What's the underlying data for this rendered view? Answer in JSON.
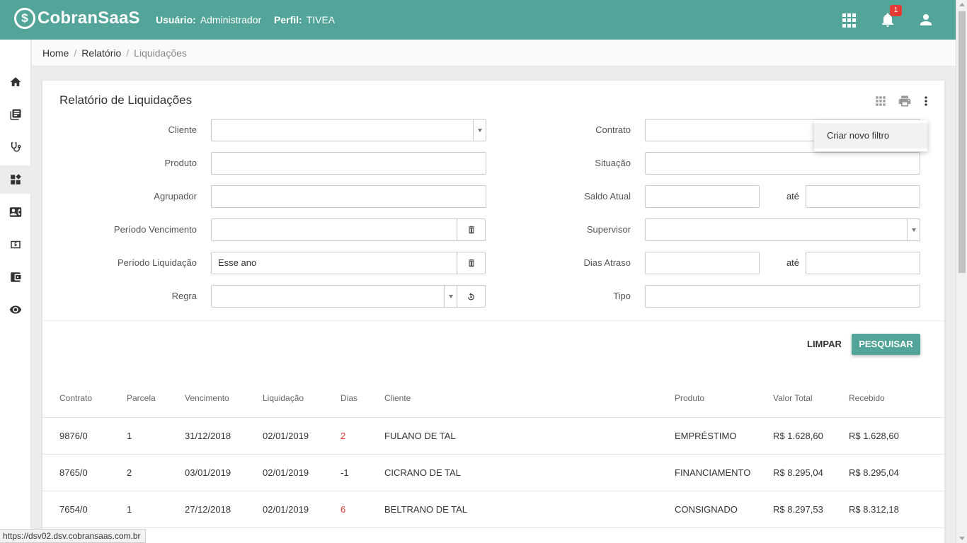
{
  "app": {
    "logo_mark": "$",
    "logo_text": "CobranSaaS",
    "user_label": "Usuário:",
    "user_value": "Administrador",
    "profile_label": "Perfil:",
    "profile_value": "TIVEA",
    "notification_count": "1",
    "primary_color": "#53a59a"
  },
  "breadcrumb": {
    "items": [
      "Home",
      "Relatório",
      "Liquidações"
    ],
    "separator": "/"
  },
  "sidebar": {
    "items": [
      "home-icon",
      "library-icon",
      "stethoscope-icon",
      "dashboard-icon",
      "contact-card-icon",
      "money-icon",
      "wallet-icon",
      "eye-icon"
    ],
    "active_index": 3
  },
  "report": {
    "title": "Relatório de Liquidações",
    "filters": {
      "cliente": {
        "label": "Cliente",
        "value": ""
      },
      "produto": {
        "label": "Produto",
        "value": ""
      },
      "agrupador": {
        "label": "Agrupador",
        "value": ""
      },
      "periodo_vencimento": {
        "label": "Período Vencimento",
        "value": ""
      },
      "periodo_liquidacao": {
        "label": "Período Liquidação",
        "value": "Esse ano"
      },
      "regra": {
        "label": "Regra",
        "value": ""
      },
      "contrato": {
        "label": "Contrato",
        "value": ""
      },
      "situacao": {
        "label": "Situação",
        "value": ""
      },
      "saldo_atual": {
        "label": "Saldo Atual",
        "from": "",
        "until_label": "até",
        "to": ""
      },
      "supervisor": {
        "label": "Supervisor",
        "value": ""
      },
      "dias_atraso": {
        "label": "Dias Atraso",
        "from": "",
        "until_label": "até",
        "to": ""
      },
      "tipo": {
        "label": "Tipo",
        "value": ""
      }
    },
    "buttons": {
      "clear": "LIMPAR",
      "search": "PESQUISAR"
    },
    "menu": {
      "items": [
        "Criar novo filtro"
      ]
    }
  },
  "table": {
    "headers": [
      "Contrato",
      "Parcela",
      "Vencimento",
      "Liquidação",
      "Dias",
      "Cliente",
      "Produto",
      "Valor Total",
      "Recebido"
    ],
    "rows": [
      [
        "9876/0",
        "1",
        "31/12/2018",
        "02/01/2019",
        "2",
        "FULANO DE TAL",
        "EMPRÉSTIMO",
        "R$ 1.628,60",
        "R$ 1.628,60"
      ],
      [
        "8765/0",
        "2",
        "03/01/2019",
        "02/01/2019",
        "-1",
        "CICRANO DE TAL",
        "FINANCIAMENTO",
        "R$ 8.295,04",
        "R$ 8.295,04"
      ],
      [
        "7654/0",
        "1",
        "27/12/2018",
        "02/01/2019",
        "6",
        "BELTRANO DE TAL",
        "CONSIGNADO",
        "R$ 8.297,53",
        "R$ 8.312,18"
      ]
    ],
    "late_color": "#e53935"
  },
  "status_url": "https://dsv02.dsv.cobransaas.com.br"
}
